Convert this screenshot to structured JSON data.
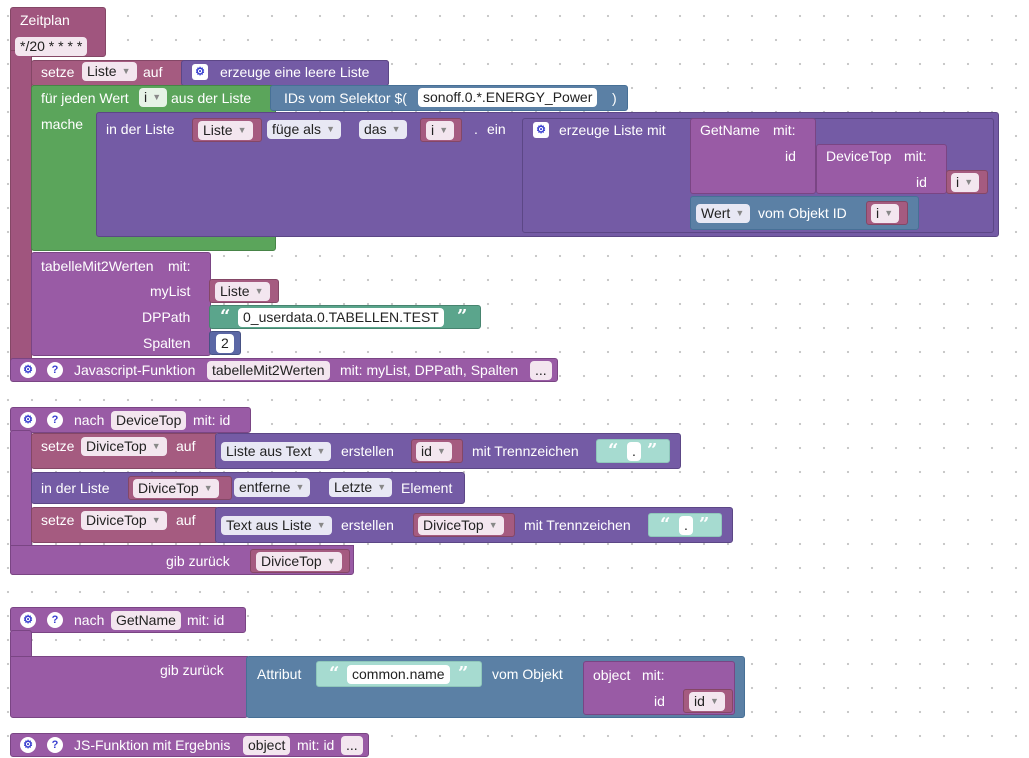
{
  "schedule": {
    "title": "Zeitplan",
    "cron": "*/20 * * * *",
    "set_list": {
      "kw": "setze",
      "var": "Liste",
      "kw2": "auf",
      "create_empty": "erzeuge eine leere Liste"
    },
    "foreach": {
      "kw": "für jeden Wert",
      "var": "i",
      "kw2": "aus der Liste",
      "selector_kw": "IDs vom Selektor $(",
      "selector_val": "sonoff.0.*.ENERGY_Power",
      "selector_close": ")",
      "do": "mache"
    },
    "insert": {
      "kw": "in der Liste",
      "list": "Liste",
      "mode": "füge als",
      "pos": "das",
      "index": "i",
      "dot": ".",
      "kw2": "ein",
      "create_with": "erzeuge Liste mit"
    },
    "getname": {
      "name": "GetName",
      "mit": "mit:",
      "id": "id"
    },
    "devicetop": {
      "name": "DeviceTop",
      "mit": "mit:",
      "id": "id",
      "var": "i"
    },
    "value": {
      "prop": "Wert",
      "kw": "vom Objekt ID",
      "var": "i"
    },
    "table_call": {
      "name": "tabelleMit2Werten",
      "mit": "mit:",
      "mylist_lbl": "myList",
      "mylist": "Liste",
      "dppath_lbl": "DPPath",
      "dppath": "0_userdata.0.TABELLEN.TEST",
      "spalten_lbl": "Spalten",
      "spalten": "2"
    }
  },
  "js_function": {
    "label": "Javascript-Funktion",
    "name": "tabelleMit2Werten",
    "params": "mit: myList, DPPath, Spalten",
    "more": "..."
  },
  "devicetop_fn": {
    "kw": "nach",
    "name": "DeviceTop",
    "params": "mit: id",
    "set1": {
      "kw": "setze",
      "var": "DiviceTop",
      "kw2": "auf",
      "mode": "Liste aus Text",
      "kw3": "erstellen",
      "arg": "id",
      "kw4": "mit Trennzeichen",
      "sep": "."
    },
    "remove": {
      "kw": "in der Liste",
      "list": "DiviceTop",
      "op": "entferne",
      "which": "Letzte",
      "kw2": "Element"
    },
    "set2": {
      "kw": "setze",
      "var": "DiviceTop",
      "kw2": "auf",
      "mode": "Text aus Liste",
      "kw3": "erstellen",
      "arg": "DiviceTop",
      "kw4": "mit Trennzeichen",
      "sep": "."
    },
    "ret": {
      "kw": "gib zurück",
      "var": "DiviceTop"
    }
  },
  "getname_fn": {
    "kw": "nach",
    "name": "GetName",
    "params": "mit: id",
    "ret": {
      "kw": "gib zurück",
      "attr_kw": "Attribut",
      "attr": "common.name",
      "obj_kw": "vom Objekt",
      "obj_fn": "object",
      "mit": "mit:",
      "id_lbl": "id",
      "id": "id"
    }
  },
  "js_result_fn": {
    "label": "JS-Funktion mit Ergebnis",
    "name": "object",
    "params": "mit: id",
    "more": "..."
  },
  "icons": {
    "gear": "gear-icon",
    "help": "help-icon",
    "dropdown": "chevron-down-icon"
  },
  "colors": {
    "procedure": "#995ba5",
    "list": "#745ba5",
    "loop": "#5ba55b",
    "variable": "#a55b80",
    "object": "#5b80a5",
    "text": "#5ba58c",
    "number": "#5b67a5"
  }
}
